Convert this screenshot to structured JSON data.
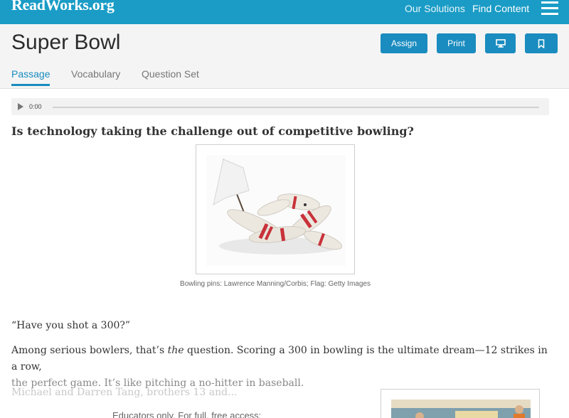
{
  "topbar": {
    "logo": "ReadWorks.org",
    "nav": {
      "solutions": "Our Solutions",
      "find_content": "Find Content"
    }
  },
  "header": {
    "title": "Super Bowl",
    "buttons": {
      "assign": "Assign",
      "print": "Print"
    },
    "tabs": [
      "Passage",
      "Vocabulary",
      "Question Set"
    ]
  },
  "audio": {
    "time": "0:00",
    "progress": 0
  },
  "article": {
    "headline": "Is technology taking the challenge out of competitive bowling?",
    "caption": "Bowling pins: Lawrence Manning/Corbis; Flag: Getty Images",
    "quote": "“Have you shot a 300?”",
    "body_1": "Among serious bowlers, that’s ",
    "body_em": "the",
    "body_2": " question. Scoring a 300 in bowling is the ultimate dream—12 strikes in a row,",
    "body_3": "the perfect game. It’s like pitching a no-hitter in baseball.",
    "faded": "Michael and Darren Tang, brothers 13 and...",
    "notice": "Educators only. For full, free access:"
  },
  "colors": {
    "brand": "#1a9cc6",
    "button": "#1a8cbf"
  }
}
